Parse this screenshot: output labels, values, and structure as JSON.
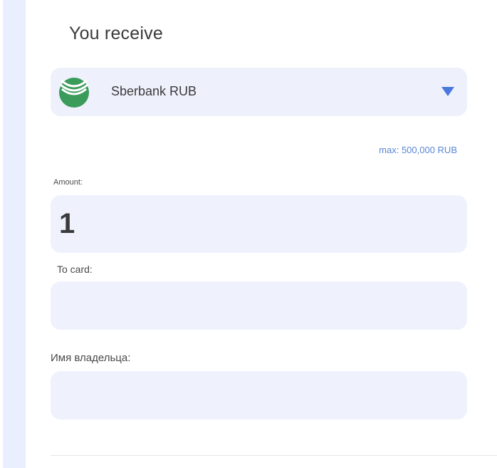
{
  "receive": {
    "title": "You receive",
    "currency": {
      "label": "Sberbank RUB",
      "icon": "sberbank-logo-icon",
      "dropdown_icon": "triangle-down-icon",
      "brand_color": "#3a9b5a",
      "accent_color": "#4a78e0"
    },
    "max_label": "max: 500,000 RUB"
  },
  "form": {
    "amount": {
      "label": "Amount:",
      "value": "1"
    },
    "card": {
      "label": "To card:",
      "value": ""
    },
    "owner": {
      "label": "Имя владельца:",
      "value": ""
    }
  }
}
